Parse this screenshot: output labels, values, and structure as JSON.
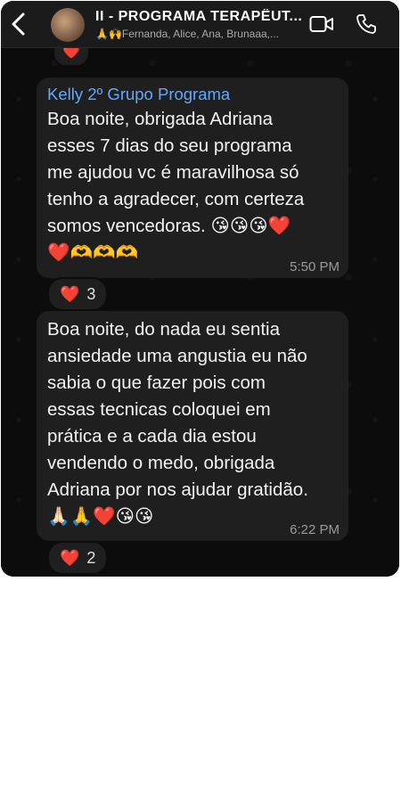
{
  "header": {
    "title": "II - PROGRAMA  TERAPÊUT...",
    "subtitle": "🙏🙌Fernanda, Alice, Ana, Brunaaa,..."
  },
  "top_reaction": {
    "emoji": "❤️"
  },
  "messages": [
    {
      "sender": "Kelly 2º Grupo Programa",
      "text": "Boa noite, obrigada Adriana\nesses 7 dias do seu programa\nme ajudou vc é maravilhosa só\ntenho a agradecer, com certeza\nsomos vencedoras. 😘😘😘❤️\n❤️🫶🫶🫶",
      "time": "5:50 PM",
      "reaction_emoji": "❤️",
      "reaction_count": "3"
    },
    {
      "text": "Boa noite, do nada eu sentia\nansiedade uma angustia eu não\nsabia o que fazer pois com\nessas tecnicas coloquei em\nprática e a cada dia estou\nvendendo o medo, obrigada\nAdriana por nos ajudar gratidão.\n🙏🏻🙏❤️😘😘",
      "time": "6:22 PM",
      "reaction_emoji": "❤️",
      "reaction_count": "2"
    }
  ]
}
